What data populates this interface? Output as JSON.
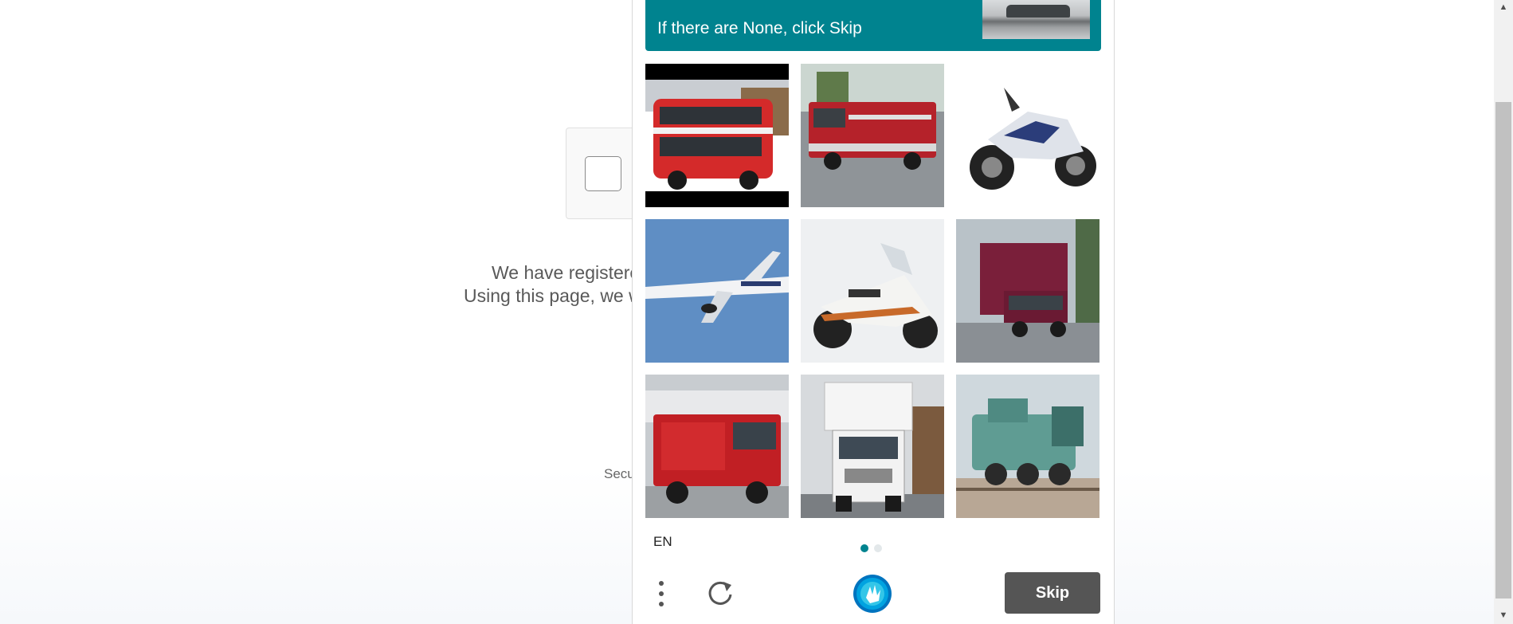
{
  "background_page": {
    "line1": "We have registere",
    "line2": "Using this page, we w",
    "footer_text": "Secu"
  },
  "captcha": {
    "prompt": "If there are None, click Skip",
    "tiles": [
      {
        "label": "double-decker bus"
      },
      {
        "label": "fire truck"
      },
      {
        "label": "motorcycle"
      },
      {
        "label": "airplane"
      },
      {
        "label": "motorcycle"
      },
      {
        "label": "truck"
      },
      {
        "label": "fire truck"
      },
      {
        "label": "truck"
      },
      {
        "label": "locomotive"
      }
    ],
    "language": "EN",
    "page_indicator": {
      "current": 1,
      "total": 2
    },
    "skip_label": "Skip",
    "accent_color": "#00838f"
  }
}
